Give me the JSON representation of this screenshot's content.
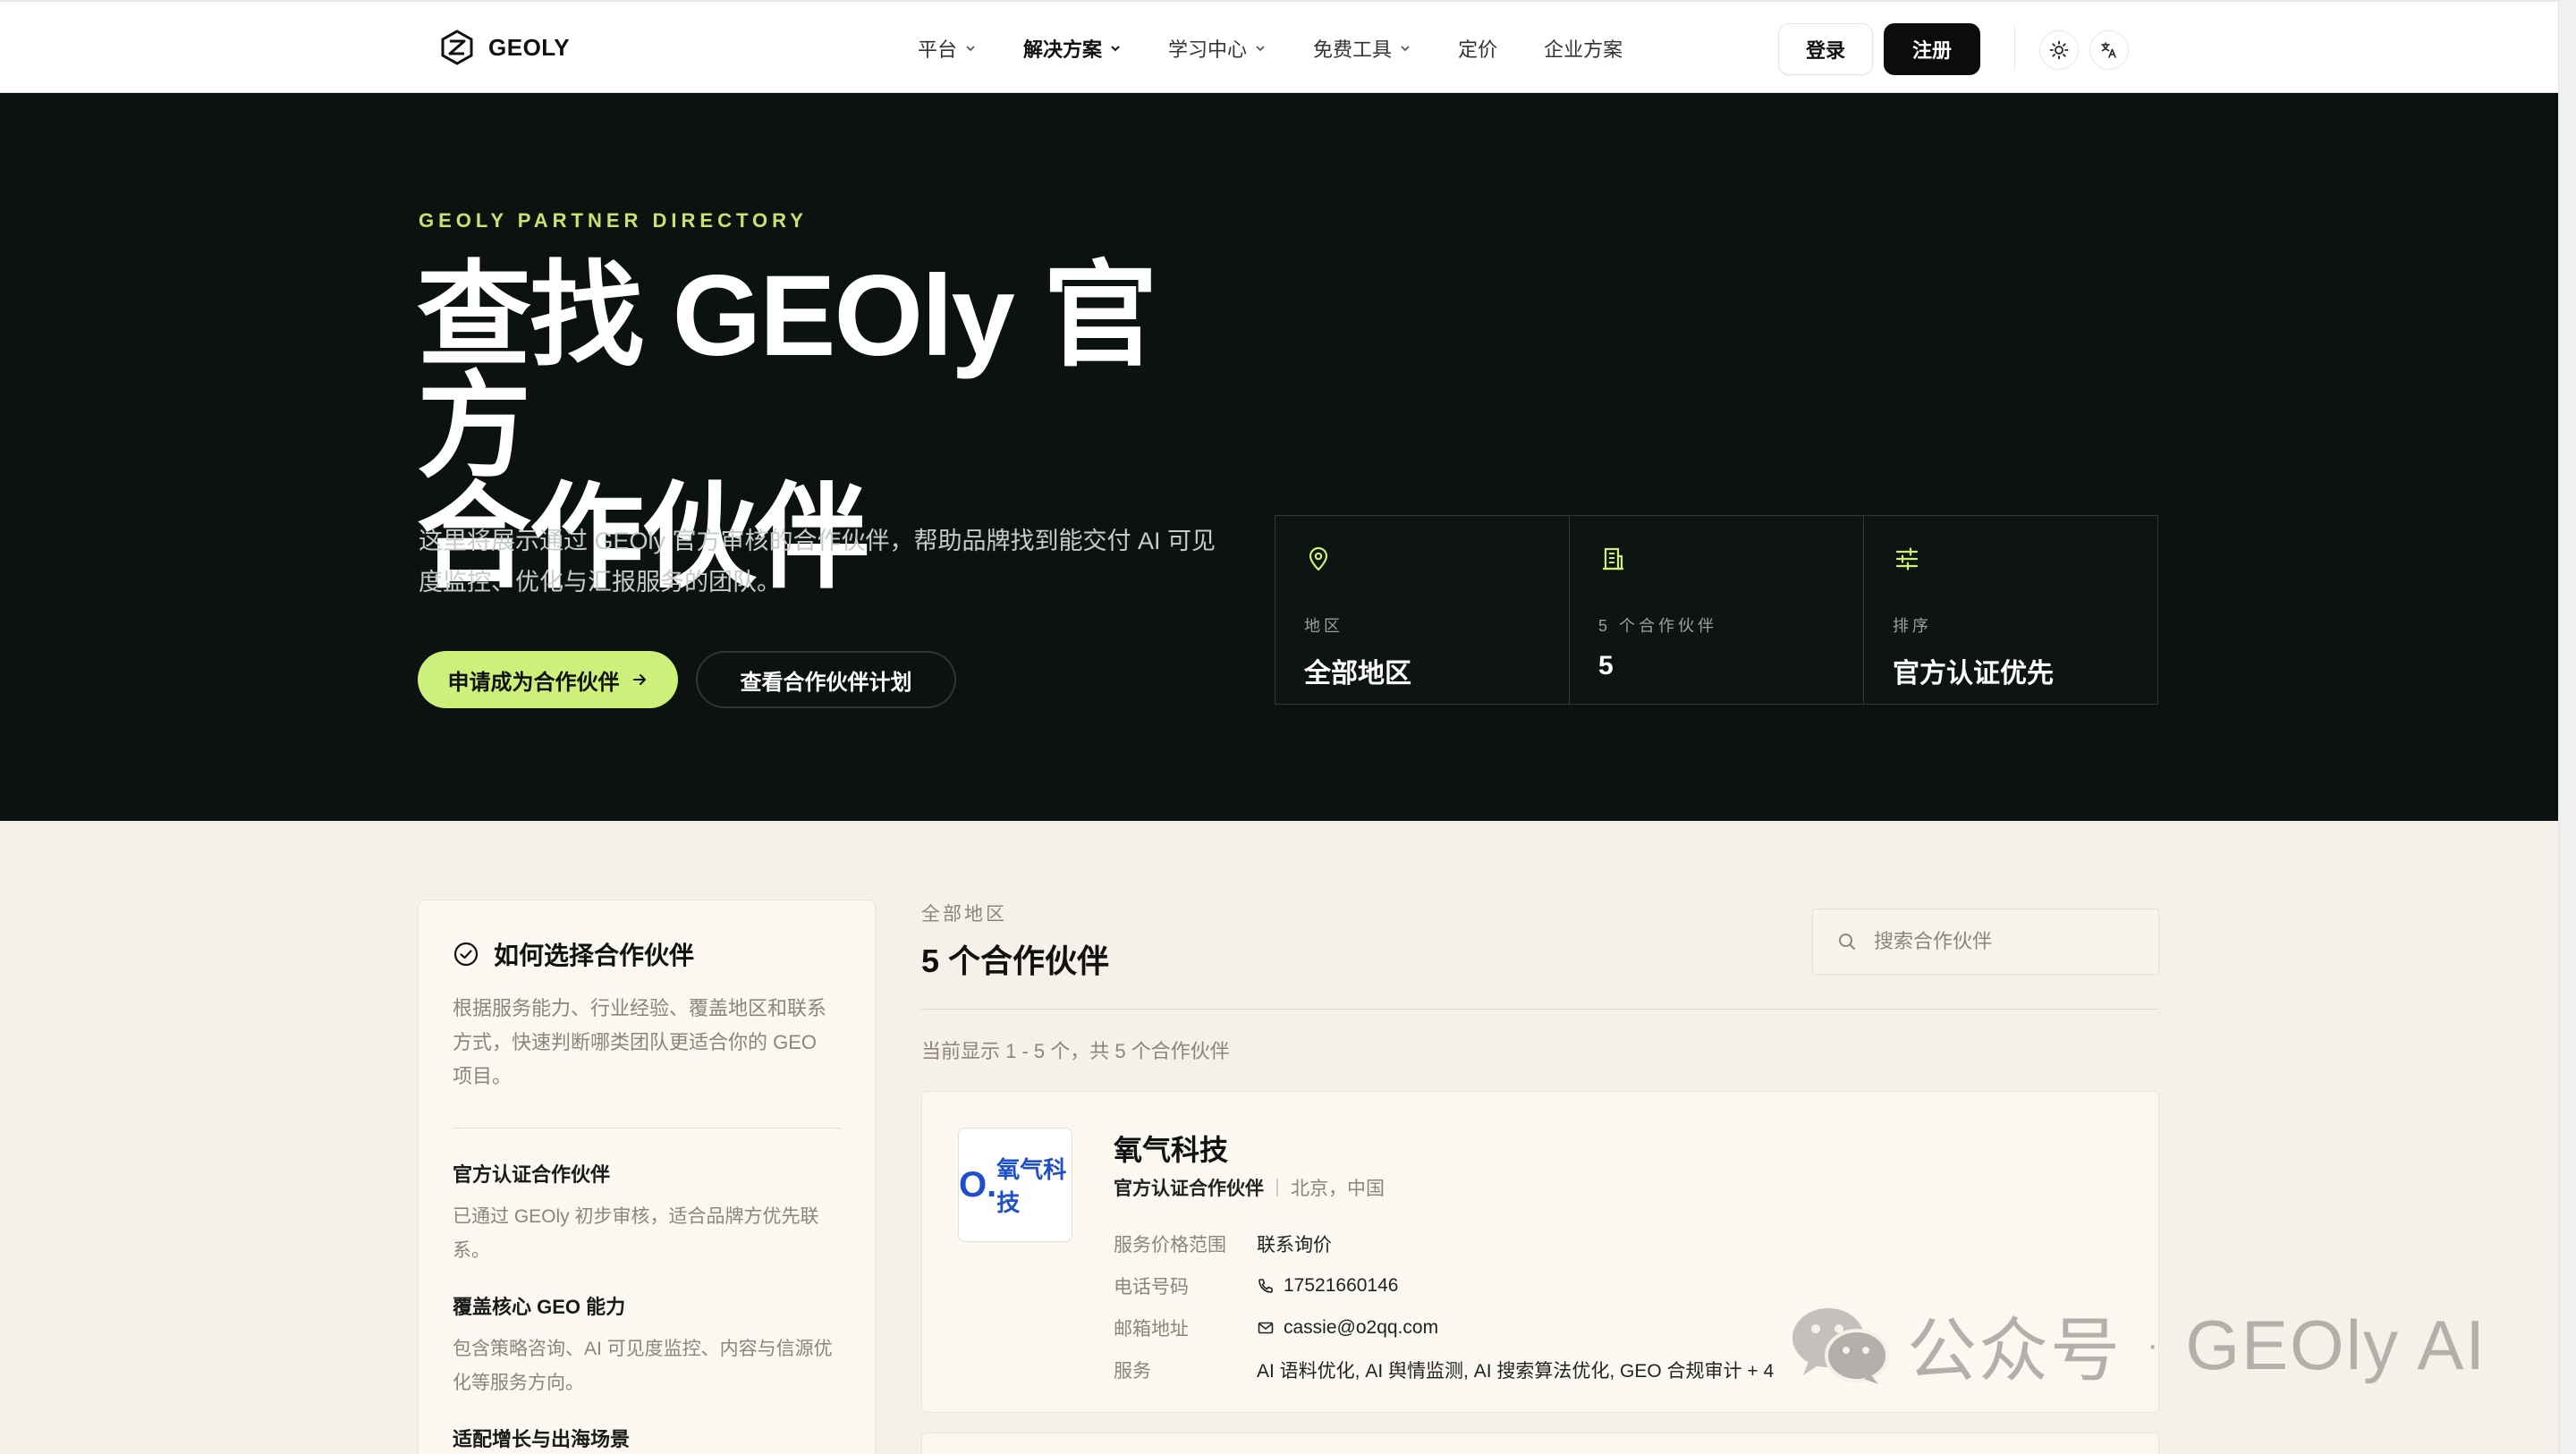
{
  "nav": {
    "logo_text": "GEOLY",
    "items": [
      {
        "label": "平台",
        "has_menu": true
      },
      {
        "label": "解决方案",
        "has_menu": true,
        "active": true
      },
      {
        "label": "学习中心",
        "has_menu": true
      },
      {
        "label": "免费工具",
        "has_menu": true
      },
      {
        "label": "定价",
        "has_menu": false
      },
      {
        "label": "企业方案",
        "has_menu": false
      }
    ],
    "login_label": "登录",
    "register_label": "注册"
  },
  "hero": {
    "eyebrow": "GEOLY PARTNER DIRECTORY",
    "title_line1": "查找 GEOly 官方",
    "title_line2": "合作伙伴",
    "description": "这里将展示通过 GEOly 官方审核的合作伙伴，帮助品牌找到能交付 AI 可见度监控、优化与汇报服务的团队。",
    "primary_cta": "申请成为合作伙伴",
    "secondary_cta": "查看合作伙伴计划",
    "stats": [
      {
        "icon": "map-pin-icon",
        "label": "地区",
        "value": "全部地区"
      },
      {
        "icon": "building-icon",
        "label": "5 个合作伙伴",
        "value": "5"
      },
      {
        "icon": "sliders-icon",
        "label": "排序",
        "value": "官方认证优先"
      }
    ]
  },
  "sidebar": {
    "heading": "如何选择合作伙伴",
    "intro": "根据服务能力、行业经验、覆盖地区和联系方式，快速判断哪类团队更适合你的 GEO 项目。",
    "sections": [
      {
        "title": "官方认证合作伙伴",
        "text": "已通过 GEOly 初步审核，适合品牌方优先联系。"
      },
      {
        "title": "覆盖核心 GEO 能力",
        "text": "包含策略咨询、AI 可见度监控、内容与信源优化等服务方向。"
      },
      {
        "title": "适配增长与出海场景",
        "text": ""
      }
    ]
  },
  "main": {
    "kicker": "全部地区",
    "title": "5 个合作伙伴",
    "search_placeholder": "搜索合作伙伴",
    "count_text": "当前显示 1 - 5 个，共 5 个合作伙伴",
    "partners": [
      {
        "logo_o": "O.",
        "logo_text": "氧气科技",
        "name": "氧气科技",
        "certification": "官方认证合作伙伴",
        "location": "北京，中国",
        "rows": [
          {
            "key": "服务价格范围",
            "value": "联系询价"
          },
          {
            "key": "电话号码",
            "value": "17521660146"
          },
          {
            "key": "邮箱地址",
            "value": "cassie@o2qq.com"
          },
          {
            "key": "服务",
            "value": "AI 语料优化, AI 舆情监测, AI 搜索算法优化, GEO 合规审计 + 4"
          }
        ]
      }
    ]
  },
  "watermark": {
    "left": "公众号",
    "dot": "·",
    "right": "GEOly AI"
  },
  "colors": {
    "accent": "#cdf07a",
    "hero_bg": "#0c1210",
    "page_bg": "#f5f0e8",
    "eyebrow": "#c9e26f"
  }
}
